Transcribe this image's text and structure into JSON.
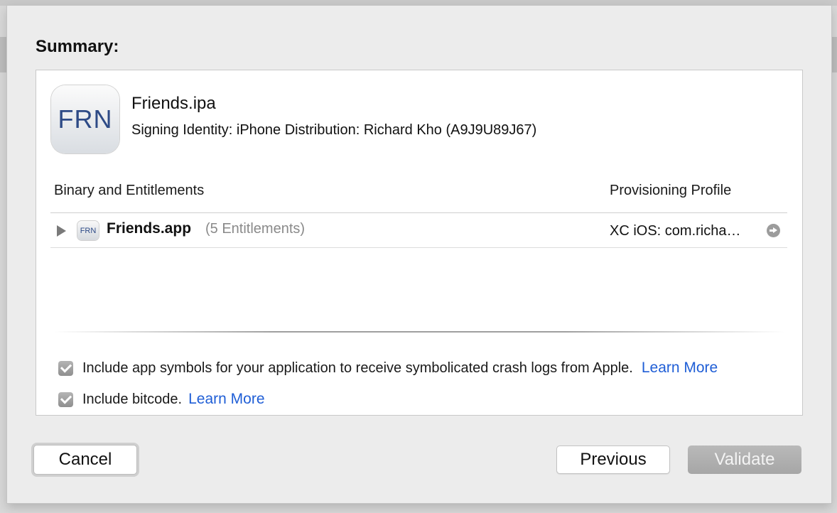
{
  "summary": {
    "title": "Summary:"
  },
  "app": {
    "icon_text": "FRN",
    "ipa_name": "Friends.ipa",
    "signing_identity": "Signing Identity: iPhone Distribution: Richard Kho (A9J9U89J67)"
  },
  "table": {
    "columns": [
      "Binary and Entitlements",
      "Provisioning Profile"
    ],
    "rows": [
      {
        "icon_text": "FRN",
        "name": "Friends.app",
        "entitlements": "(5 Entitlements)",
        "profile": "XC iOS: com.richa…",
        "expanded": false
      }
    ]
  },
  "options": [
    {
      "label": "Include app symbols for your application to receive symbolicated crash logs from Apple.",
      "link": "Learn More",
      "checked": true
    },
    {
      "label": "Include bitcode.",
      "link": "Learn More",
      "checked": true
    }
  ],
  "buttons": {
    "cancel": "Cancel",
    "previous": "Previous",
    "validate": "Validate"
  },
  "colors": {
    "link": "#1f5ed6",
    "disabled_button": "#adadad",
    "sheet_background": "#ececec"
  }
}
